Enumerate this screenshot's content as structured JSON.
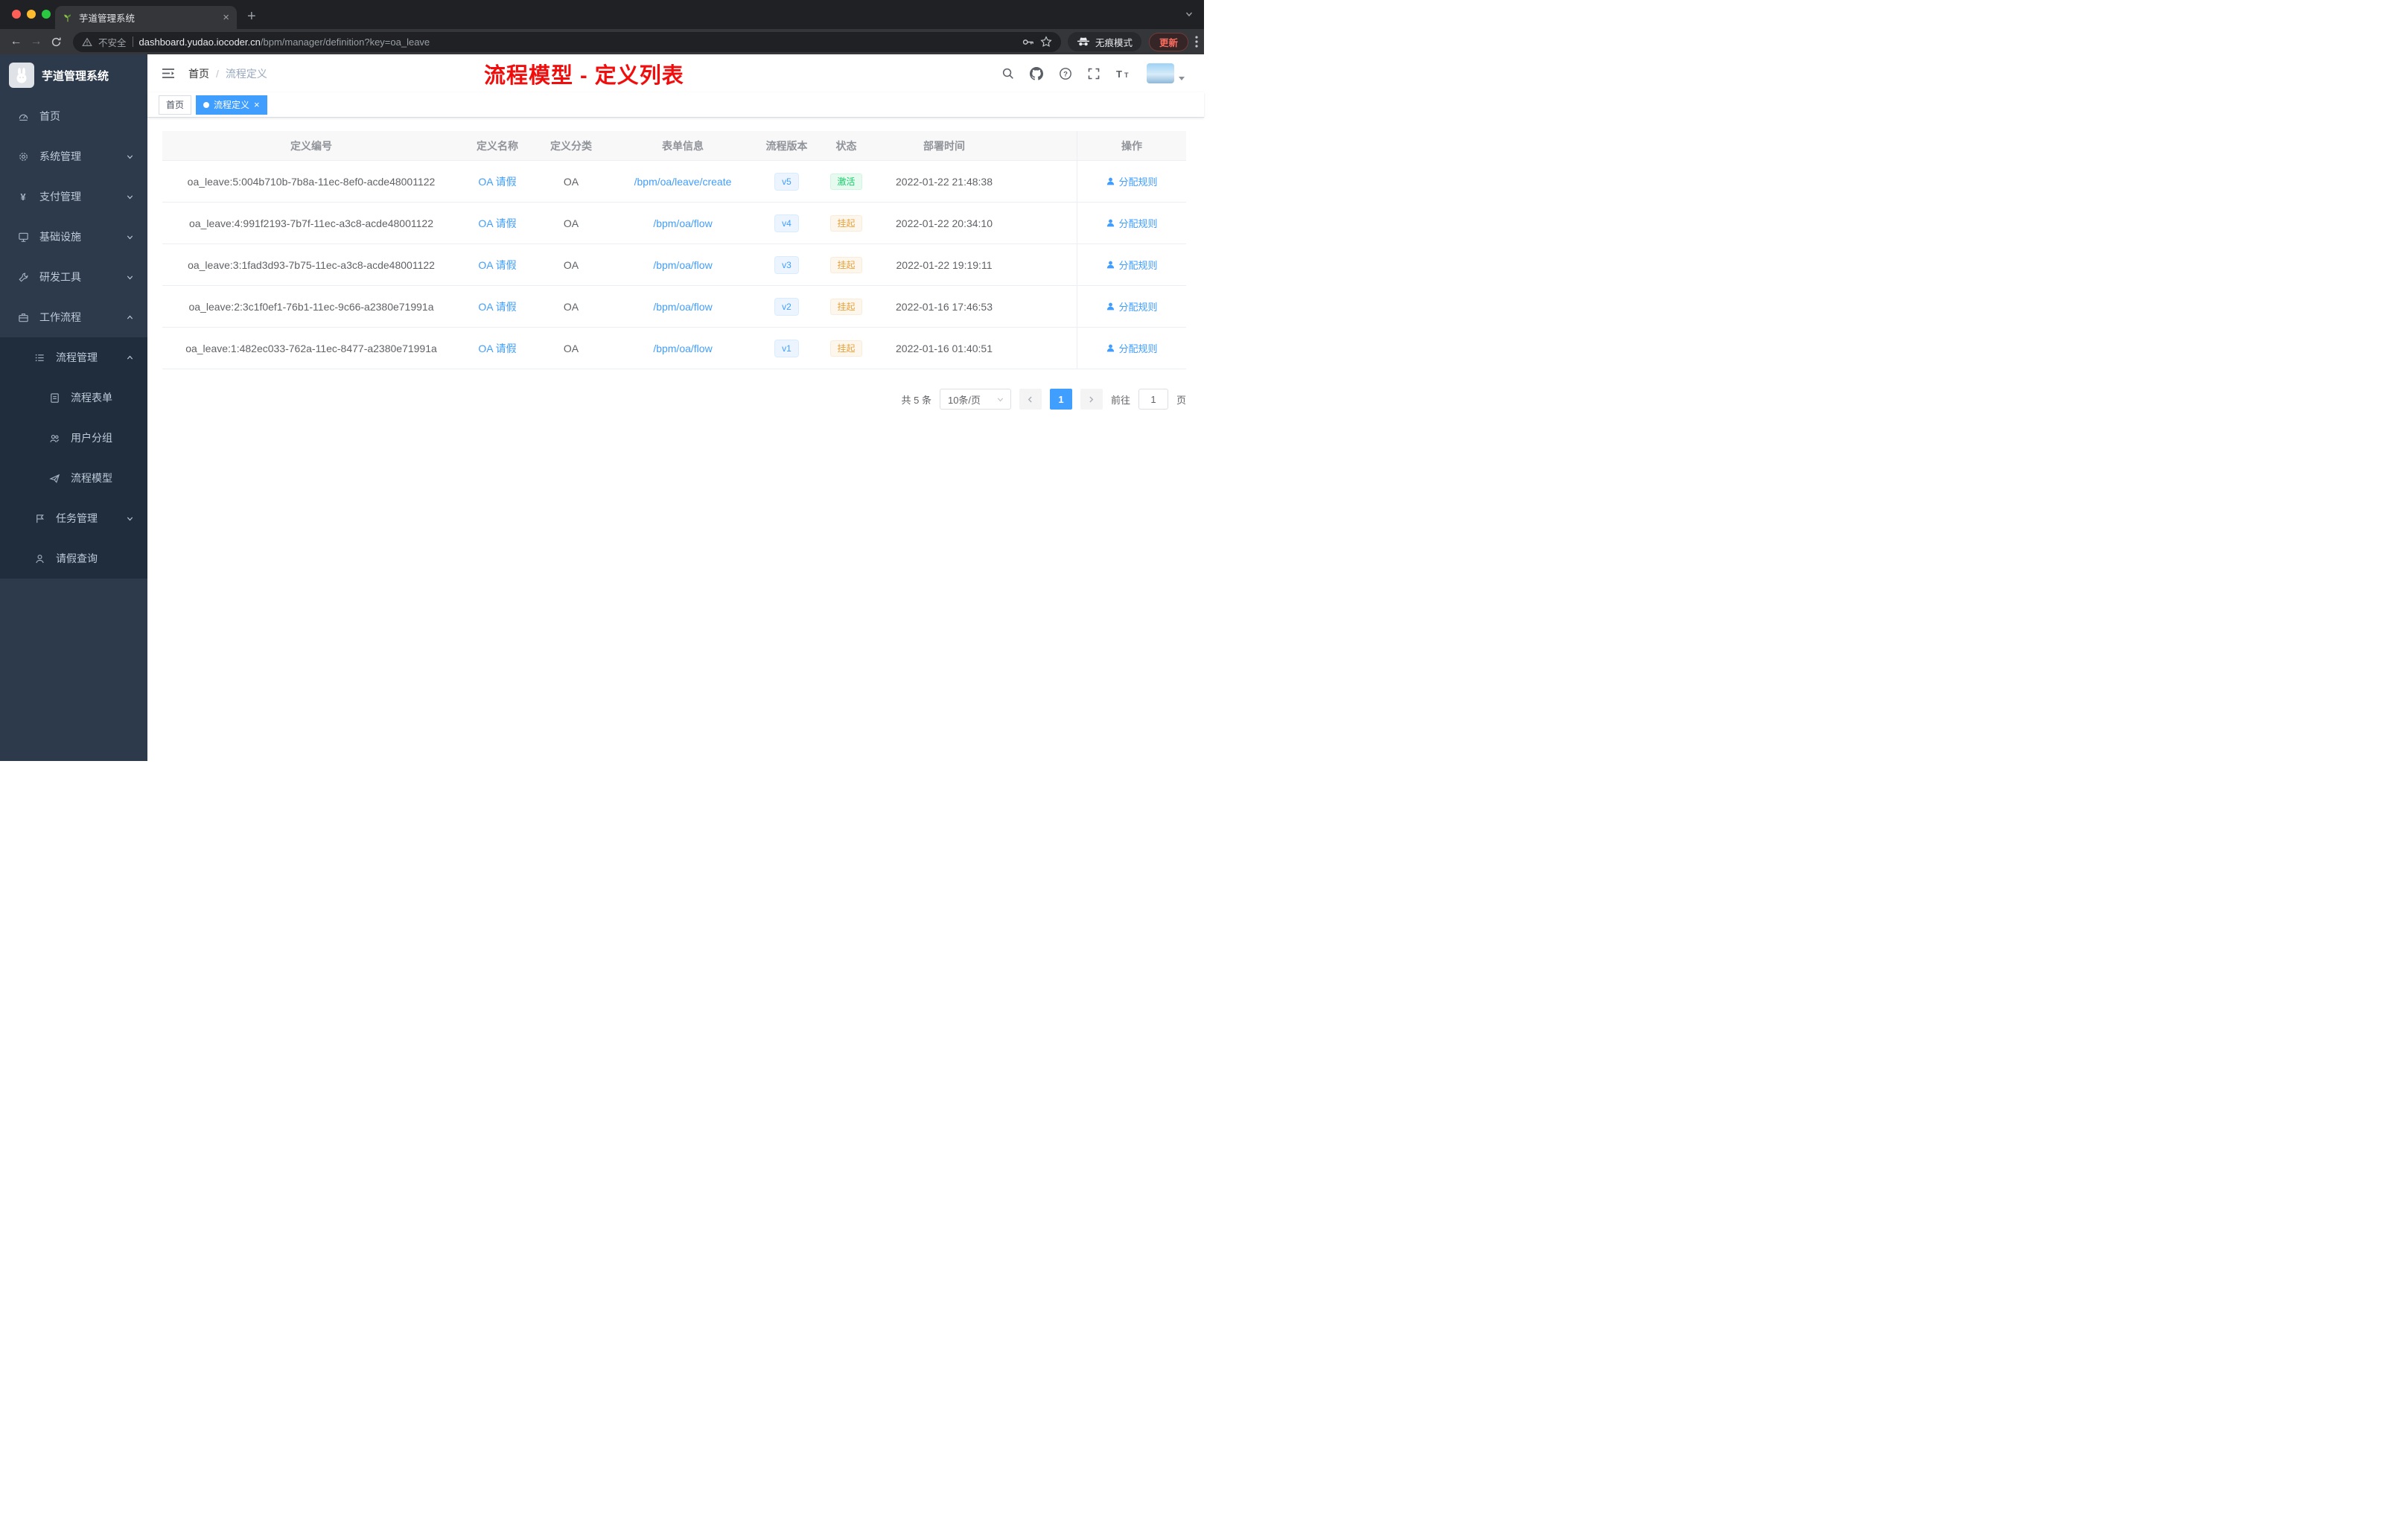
{
  "browser": {
    "tab_title": "芋道管理系统",
    "security_label": "不安全",
    "url_host": "dashboard.yudao.iocoder.cn",
    "url_path": "/bpm/manager/definition?key=oa_leave",
    "incognito_label": "无痕模式",
    "update_label": "更新"
  },
  "sidebar": {
    "logo_title": "芋道管理系统",
    "items": [
      {
        "label": "首页",
        "icon": "gauge-icon",
        "level": 1,
        "sub": false
      },
      {
        "label": "系统管理",
        "icon": "gear-icon",
        "level": 1,
        "chevron": "down",
        "sub": false
      },
      {
        "label": "支付管理",
        "icon": "yen-icon",
        "level": 1,
        "chevron": "down",
        "sub": false
      },
      {
        "label": "基础设施",
        "icon": "infra-icon",
        "level": 1,
        "chevron": "down",
        "sub": false
      },
      {
        "label": "研发工具",
        "icon": "tools-icon",
        "level": 1,
        "chevron": "down",
        "sub": false
      },
      {
        "label": "工作流程",
        "icon": "workflow-icon",
        "level": 1,
        "chevron": "up",
        "sub": false
      },
      {
        "label": "流程管理",
        "icon": "process-icon",
        "level": 2,
        "chevron": "up",
        "sub": true
      },
      {
        "label": "流程表单",
        "icon": "form-icon",
        "level": 3,
        "sub": true
      },
      {
        "label": "用户分组",
        "icon": "group-icon",
        "level": 3,
        "sub": true
      },
      {
        "label": "流程模型",
        "icon": "model-icon",
        "level": 3,
        "sub": true
      },
      {
        "label": "任务管理",
        "icon": "task-icon",
        "level": 2,
        "chevron": "down",
        "sub": true
      },
      {
        "label": "请假查询",
        "icon": "user-icon",
        "level": 2,
        "sub": true
      }
    ]
  },
  "header": {
    "breadcrumb": [
      "首页",
      "流程定义"
    ],
    "overlay_title": "流程模型 - 定义列表"
  },
  "tags": [
    {
      "label": "首页",
      "active": false
    },
    {
      "label": "流程定义",
      "active": true
    }
  ],
  "table": {
    "columns": [
      "定义编号",
      "定义名称",
      "定义分类",
      "表单信息",
      "流程版本",
      "状态",
      "部署时间",
      "操作"
    ],
    "rows": [
      {
        "id": "oa_leave:5:004b710b-7b8a-11ec-8ef0-acde48001122",
        "name": "OA 请假",
        "category": "OA",
        "form": "/bpm/oa/leave/create",
        "version": "v5",
        "status": "激活",
        "status_type": "success",
        "time": "2022-01-22 21:48:38",
        "action": "分配规则"
      },
      {
        "id": "oa_leave:4:991f2193-7b7f-11ec-a3c8-acde48001122",
        "name": "OA 请假",
        "category": "OA",
        "form": "/bpm/oa/flow",
        "version": "v4",
        "status": "挂起",
        "status_type": "warning",
        "time": "2022-01-22 20:34:10",
        "action": "分配规则"
      },
      {
        "id": "oa_leave:3:1fad3d93-7b75-11ec-a3c8-acde48001122",
        "name": "OA 请假",
        "category": "OA",
        "form": "/bpm/oa/flow",
        "version": "v3",
        "status": "挂起",
        "status_type": "warning",
        "time": "2022-01-22 19:19:11",
        "action": "分配规则"
      },
      {
        "id": "oa_leave:2:3c1f0ef1-76b1-11ec-9c66-a2380e71991a",
        "name": "OA 请假",
        "category": "OA",
        "form": "/bpm/oa/flow",
        "version": "v2",
        "status": "挂起",
        "status_type": "warning",
        "time": "2022-01-16 17:46:53",
        "action": "分配规则"
      },
      {
        "id": "oa_leave:1:482ec033-762a-11ec-8477-a2380e71991a",
        "name": "OA 请假",
        "category": "OA",
        "form": "/bpm/oa/flow",
        "version": "v1",
        "status": "挂起",
        "status_type": "warning",
        "time": "2022-01-16 01:40:51",
        "action": "分配规则"
      }
    ]
  },
  "pagination": {
    "total": "共 5 条",
    "page_size": "10条/页",
    "page": "1",
    "goto": "前往",
    "unit": "页"
  },
  "colors": {
    "accent": "#409eff",
    "success": "#13ce66",
    "warning": "#e6a23c",
    "overlay_title_red": "#f20d0d",
    "sidebar_bg": "#2d3a4b",
    "submenu_bg": "#1f2d3d"
  }
}
